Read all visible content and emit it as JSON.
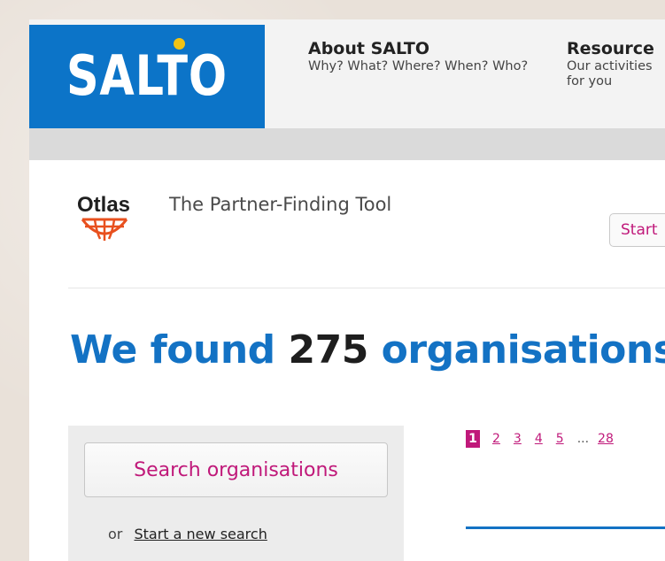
{
  "header": {
    "logo_text": "SALTO",
    "nav": [
      {
        "title": "About SALTO",
        "subtitle": "Why? What? Where? When? Who?"
      },
      {
        "title": "Resource",
        "subtitle": "Our activities for you"
      }
    ]
  },
  "tool": {
    "brand": "Otlas",
    "tagline": "The Partner-Finding Tool",
    "start_label": "Start"
  },
  "results": {
    "prefix": "We found",
    "count": "275",
    "suffix": "organisations"
  },
  "sidebar": {
    "search_button": "Search organisations",
    "or_text": "or",
    "new_search_link": "Start a new search"
  },
  "pagination": {
    "current": "1",
    "pages": [
      "2",
      "3",
      "4",
      "5"
    ],
    "ellipsis": "...",
    "last": "28"
  },
  "colors": {
    "brand_blue": "#0c74c8",
    "accent_magenta": "#c0197a",
    "sun_yellow": "#f3c314",
    "otlas_orange": "#e8501e"
  }
}
